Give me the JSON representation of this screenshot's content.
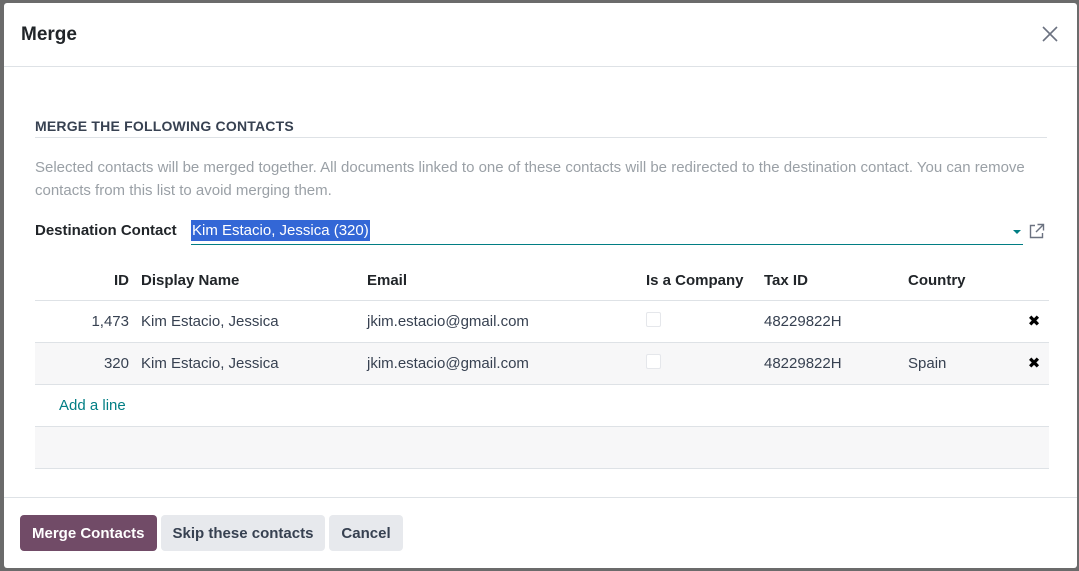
{
  "dialog": {
    "title": "Merge"
  },
  "section": {
    "title": "MERGE THE FOLLOWING CONTACTS",
    "help": "Selected contacts will be merged together. All documents linked to one of these contacts will be redirected to the destination contact. You can remove contacts from this list to avoid merging them."
  },
  "destination": {
    "label": "Destination Contact",
    "value": "Kim Estacio, Jessica (320)"
  },
  "table": {
    "headers": {
      "id": "ID",
      "name": "Display Name",
      "email": "Email",
      "is_company": "Is a Company",
      "tax_id": "Tax ID",
      "country": "Country"
    },
    "rows": [
      {
        "id": "1,473",
        "name": "Kim Estacio, Jessica",
        "email": "jkim.estacio@gmail.com",
        "is_company": false,
        "tax_id": "48229822H",
        "country": ""
      },
      {
        "id": "320",
        "name": "Kim Estacio, Jessica",
        "email": "jkim.estacio@gmail.com",
        "is_company": false,
        "tax_id": "48229822H",
        "country": "Spain"
      }
    ],
    "add_line": "Add a line",
    "delete_icon": "✖"
  },
  "footer": {
    "merge_label": "Merge Contacts",
    "skip_label": "Skip these contacts",
    "cancel_label": "Cancel"
  },
  "icons": {
    "close": "close-icon",
    "external": "external-link-icon",
    "dropdown": "caret-down-icon"
  },
  "colors": {
    "primary": "#714b67",
    "accent": "#017e84",
    "selection": "#3367d6"
  }
}
